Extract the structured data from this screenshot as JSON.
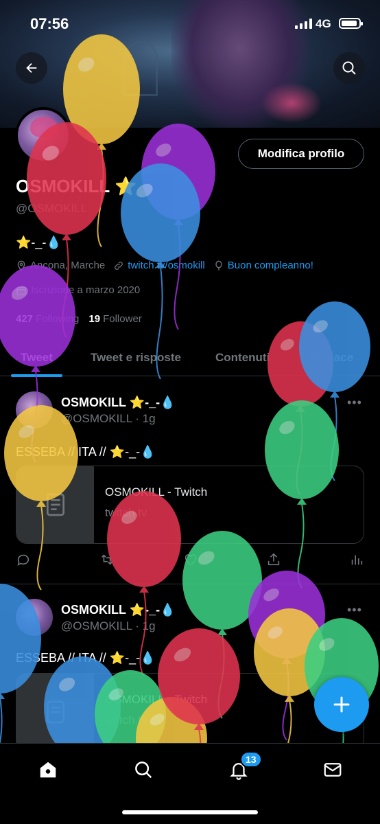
{
  "status_bar": {
    "time": "07:56",
    "network": "4G"
  },
  "profile": {
    "display_name": "OSMOKILL ⭐",
    "handle": "@OSMOKILL",
    "edit_button": "Modifica profilo",
    "bio": "⭐-_-💧",
    "location": "Ancona, Marche",
    "website": "twitch.tv/osmokill",
    "birthday": "Buon compleanno!",
    "joined": "Iscrizione a marzo 2020",
    "following_count": "427",
    "following_label": "Following",
    "followers_count": "19",
    "followers_label": "Follower"
  },
  "tabs": [
    {
      "label": "Tweet",
      "active": true
    },
    {
      "label": "Tweet e risposte",
      "active": false
    },
    {
      "label": "Contenuti",
      "active": false
    },
    {
      "label": "Mi piace",
      "active": false
    }
  ],
  "tweets": [
    {
      "name": "OSMOKILL ⭐-_-💧",
      "handle_time": "@OSMOKILL · 1g",
      "text": "ESSEBA // ITA // ⭐-_-💧",
      "card_title": "OSMOKILL - Twitch",
      "card_url": "twitch.tv"
    },
    {
      "name": "OSMOKILL ⭐-_-💧",
      "handle_time": "@OSMOKILL · 1g",
      "text": "ESSEBA // ITA // ⭐-_-💧",
      "card_title": "OSMOKILL - Twitch",
      "card_url": "twitch.tv"
    }
  ],
  "more_glyph": "•••",
  "bottom_nav": {
    "notifications_badge": "13"
  },
  "balloons": [
    {
      "color": "#f4c842"
    },
    {
      "color": "#e0344f"
    },
    {
      "color": "#9b30d9"
    },
    {
      "color": "#3b8fe0"
    },
    {
      "color": "#9b30d9"
    },
    {
      "color": "#e0344f"
    },
    {
      "color": "#3b8fe0"
    },
    {
      "color": "#f4c842"
    },
    {
      "color": "#3ccf82"
    },
    {
      "color": "#e0344f"
    },
    {
      "color": "#3ccf82"
    },
    {
      "color": "#9b30d9"
    },
    {
      "color": "#f4c842"
    },
    {
      "color": "#3ccf82"
    },
    {
      "color": "#3b8fe0"
    },
    {
      "color": "#3b8fe0"
    },
    {
      "color": "#3ccf82"
    },
    {
      "color": "#f4c842"
    },
    {
      "color": "#e0344f"
    }
  ],
  "colors": {
    "accent": "#1d9bf0",
    "background": "#000000",
    "muted": "#71767b",
    "border": "#2f3336"
  }
}
